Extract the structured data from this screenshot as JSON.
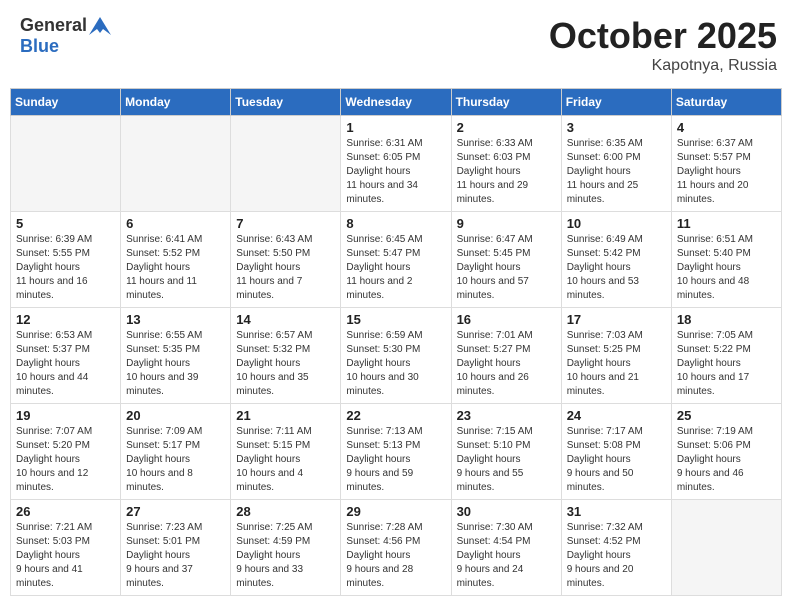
{
  "header": {
    "logo_general": "General",
    "logo_blue": "Blue",
    "month_title": "October 2025",
    "location": "Kapotnya, Russia"
  },
  "days_of_week": [
    "Sunday",
    "Monday",
    "Tuesday",
    "Wednesday",
    "Thursday",
    "Friday",
    "Saturday"
  ],
  "weeks": [
    [
      {
        "day": "",
        "empty": true
      },
      {
        "day": "",
        "empty": true
      },
      {
        "day": "",
        "empty": true
      },
      {
        "day": "1",
        "sunrise": "6:31 AM",
        "sunset": "6:05 PM",
        "daylight": "11 hours and 34 minutes."
      },
      {
        "day": "2",
        "sunrise": "6:33 AM",
        "sunset": "6:03 PM",
        "daylight": "11 hours and 29 minutes."
      },
      {
        "day": "3",
        "sunrise": "6:35 AM",
        "sunset": "6:00 PM",
        "daylight": "11 hours and 25 minutes."
      },
      {
        "day": "4",
        "sunrise": "6:37 AM",
        "sunset": "5:57 PM",
        "daylight": "11 hours and 20 minutes."
      }
    ],
    [
      {
        "day": "5",
        "sunrise": "6:39 AM",
        "sunset": "5:55 PM",
        "daylight": "11 hours and 16 minutes."
      },
      {
        "day": "6",
        "sunrise": "6:41 AM",
        "sunset": "5:52 PM",
        "daylight": "11 hours and 11 minutes."
      },
      {
        "day": "7",
        "sunrise": "6:43 AM",
        "sunset": "5:50 PM",
        "daylight": "11 hours and 7 minutes."
      },
      {
        "day": "8",
        "sunrise": "6:45 AM",
        "sunset": "5:47 PM",
        "daylight": "11 hours and 2 minutes."
      },
      {
        "day": "9",
        "sunrise": "6:47 AM",
        "sunset": "5:45 PM",
        "daylight": "10 hours and 57 minutes."
      },
      {
        "day": "10",
        "sunrise": "6:49 AM",
        "sunset": "5:42 PM",
        "daylight": "10 hours and 53 minutes."
      },
      {
        "day": "11",
        "sunrise": "6:51 AM",
        "sunset": "5:40 PM",
        "daylight": "10 hours and 48 minutes."
      }
    ],
    [
      {
        "day": "12",
        "sunrise": "6:53 AM",
        "sunset": "5:37 PM",
        "daylight": "10 hours and 44 minutes."
      },
      {
        "day": "13",
        "sunrise": "6:55 AM",
        "sunset": "5:35 PM",
        "daylight": "10 hours and 39 minutes."
      },
      {
        "day": "14",
        "sunrise": "6:57 AM",
        "sunset": "5:32 PM",
        "daylight": "10 hours and 35 minutes."
      },
      {
        "day": "15",
        "sunrise": "6:59 AM",
        "sunset": "5:30 PM",
        "daylight": "10 hours and 30 minutes."
      },
      {
        "day": "16",
        "sunrise": "7:01 AM",
        "sunset": "5:27 PM",
        "daylight": "10 hours and 26 minutes."
      },
      {
        "day": "17",
        "sunrise": "7:03 AM",
        "sunset": "5:25 PM",
        "daylight": "10 hours and 21 minutes."
      },
      {
        "day": "18",
        "sunrise": "7:05 AM",
        "sunset": "5:22 PM",
        "daylight": "10 hours and 17 minutes."
      }
    ],
    [
      {
        "day": "19",
        "sunrise": "7:07 AM",
        "sunset": "5:20 PM",
        "daylight": "10 hours and 12 minutes."
      },
      {
        "day": "20",
        "sunrise": "7:09 AM",
        "sunset": "5:17 PM",
        "daylight": "10 hours and 8 minutes."
      },
      {
        "day": "21",
        "sunrise": "7:11 AM",
        "sunset": "5:15 PM",
        "daylight": "10 hours and 4 minutes."
      },
      {
        "day": "22",
        "sunrise": "7:13 AM",
        "sunset": "5:13 PM",
        "daylight": "9 hours and 59 minutes."
      },
      {
        "day": "23",
        "sunrise": "7:15 AM",
        "sunset": "5:10 PM",
        "daylight": "9 hours and 55 minutes."
      },
      {
        "day": "24",
        "sunrise": "7:17 AM",
        "sunset": "5:08 PM",
        "daylight": "9 hours and 50 minutes."
      },
      {
        "day": "25",
        "sunrise": "7:19 AM",
        "sunset": "5:06 PM",
        "daylight": "9 hours and 46 minutes."
      }
    ],
    [
      {
        "day": "26",
        "sunrise": "7:21 AM",
        "sunset": "5:03 PM",
        "daylight": "9 hours and 41 minutes."
      },
      {
        "day": "27",
        "sunrise": "7:23 AM",
        "sunset": "5:01 PM",
        "daylight": "9 hours and 37 minutes."
      },
      {
        "day": "28",
        "sunrise": "7:25 AM",
        "sunset": "4:59 PM",
        "daylight": "9 hours and 33 minutes."
      },
      {
        "day": "29",
        "sunrise": "7:28 AM",
        "sunset": "4:56 PM",
        "daylight": "9 hours and 28 minutes."
      },
      {
        "day": "30",
        "sunrise": "7:30 AM",
        "sunset": "4:54 PM",
        "daylight": "9 hours and 24 minutes."
      },
      {
        "day": "31",
        "sunrise": "7:32 AM",
        "sunset": "4:52 PM",
        "daylight": "9 hours and 20 minutes."
      },
      {
        "day": "",
        "empty": true
      }
    ]
  ]
}
